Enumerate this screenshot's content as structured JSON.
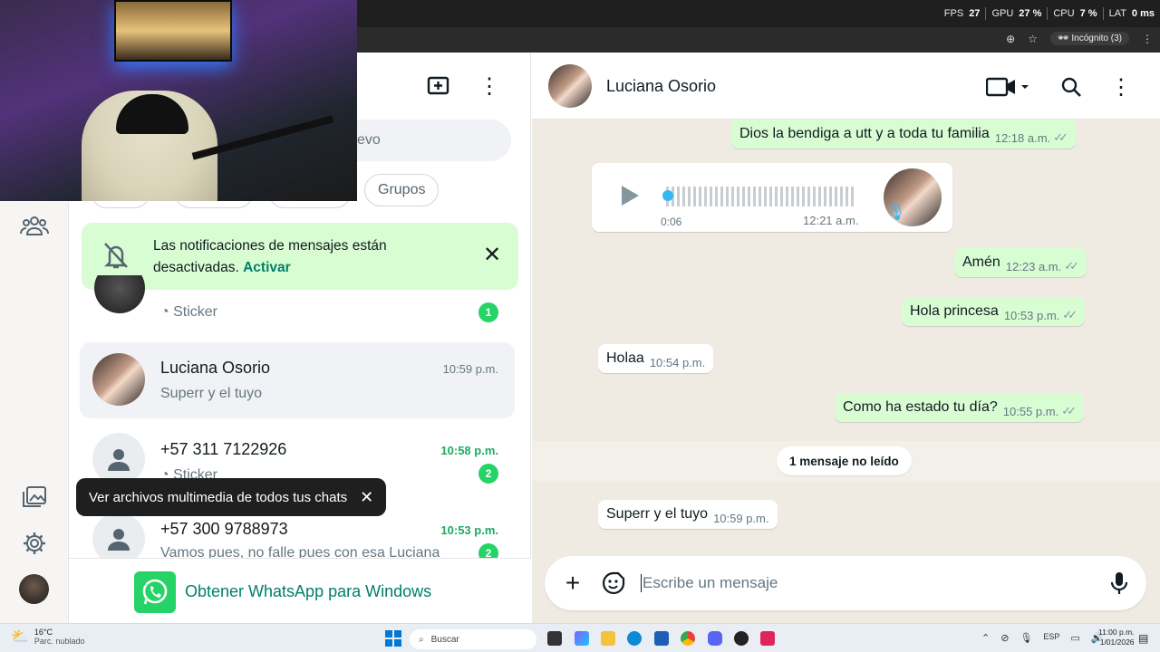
{
  "overlay_stats": {
    "fps_label": "FPS",
    "fps": "27",
    "gpu_label": "GPU",
    "gpu": "27 %",
    "cpu_label": "CPU",
    "cpu": "7 %",
    "lat_label": "LAT",
    "lat": "0 ms"
  },
  "browser": {
    "incognito_label": "Incógnito (3)"
  },
  "chatlist": {
    "search_placeholder_visible": "evo",
    "filter_chip": "Grupos",
    "notification": {
      "text": "Las notificaciones de mensajes están desactivadas.",
      "action": "Activar"
    },
    "chats": [
      {
        "name": "",
        "preview": "Sticker",
        "time": "",
        "unread": "1"
      },
      {
        "name": "Luciana Osorio",
        "preview": "Superr y el tuyo",
        "time": "10:59 p.m.",
        "unread": ""
      },
      {
        "name": "+57 311 7122926",
        "preview": "Sticker",
        "time": "10:58 p.m.",
        "unread": "2"
      },
      {
        "name": "+57 300 9788973",
        "preview": "Vamos pues, no falle pues con esa Luciana",
        "time": "10:53 p.m.",
        "unread": "2"
      }
    ],
    "get_app": "Obtener WhatsApp para Windows"
  },
  "tooltip": {
    "text": "Ver archivos multimedia de todos tus chats"
  },
  "conversation": {
    "contact_name": "Luciana Osorio",
    "messages": [
      {
        "dir": "out",
        "text": "Dios la bendiga a utt y a toda tu familia",
        "time": "12:18 a.m."
      },
      {
        "dir": "in",
        "type": "audio",
        "duration": "0:06",
        "time": "12:21 a.m."
      },
      {
        "dir": "out",
        "text": "Amén",
        "time": "12:23 a.m."
      },
      {
        "dir": "out",
        "text": "Hola princesa",
        "time": "10:53 p.m."
      },
      {
        "dir": "in",
        "text": "Holaa",
        "time": "10:54 p.m."
      },
      {
        "dir": "out",
        "text": "Como ha estado tu día?",
        "time": "10:55 p.m."
      },
      {
        "dir": "in",
        "text": "Superr y el tuyo",
        "time": "10:59 p.m."
      }
    ],
    "unread_divider": "1 mensaje no leído",
    "composer_placeholder": "Escribe un mensaje"
  },
  "taskbar": {
    "weather_temp": "16°C",
    "weather_desc": "Parc. nublado",
    "search_label": "Buscar",
    "lang": "ESP",
    "clock_time": "11:00 p.m.",
    "clock_date": "1/01/2026"
  },
  "colors": {
    "accent": "#25d366",
    "bubble_out": "#d9fdd3",
    "chat_bg": "#efeae2",
    "link": "#008069"
  }
}
